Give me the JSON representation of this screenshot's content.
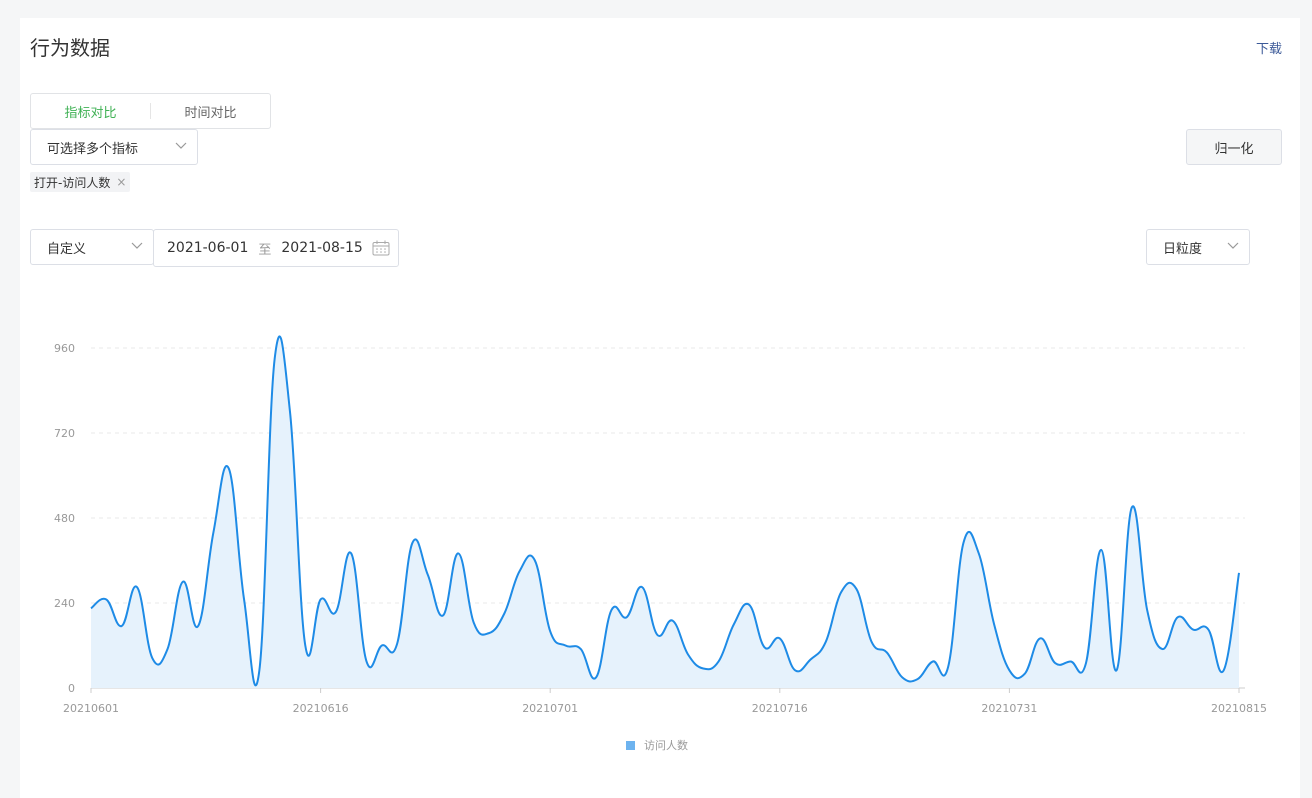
{
  "header": {
    "title": "行为数据",
    "download_label": "下载"
  },
  "compare_tabs": [
    {
      "label": "指标对比",
      "active": true
    },
    {
      "label": "时间对比",
      "active": false
    }
  ],
  "metric_select": {
    "placeholder": "可选择多个指标",
    "icon": "chevron-down-icon"
  },
  "normalize_button": {
    "label": "归一化"
  },
  "selected_tags": [
    {
      "label": "打开-访问人数",
      "icon": "close-icon"
    }
  ],
  "range_select": {
    "value": "自定义",
    "icon": "chevron-down-icon"
  },
  "date_range": {
    "start": "2021-06-01",
    "separator": "至",
    "end": "2021-08-15",
    "icon": "calendar-icon"
  },
  "granularity_select": {
    "value": "日粒度",
    "icon": "chevron-down-icon"
  },
  "colors": {
    "accent": "#3fb154",
    "line": "#1e8be6",
    "area": "#e6f2fc",
    "legend": "#6db3ef"
  },
  "chart_data": {
    "type": "area",
    "title": "",
    "xlabel": "",
    "ylabel": "",
    "ylim": [
      0,
      960
    ],
    "y_ticks": [
      "0",
      "240",
      "480",
      "720",
      "960"
    ],
    "x_ticks": [
      "20210601",
      "20210616",
      "20210701",
      "20210716",
      "20210731",
      "20210815"
    ],
    "grid": true,
    "legend_position": "bottom",
    "x": [
      "20210601",
      "20210602",
      "20210603",
      "20210604",
      "20210605",
      "20210606",
      "20210607",
      "20210608",
      "20210609",
      "20210610",
      "20210611",
      "20210612",
      "20210613",
      "20210614",
      "20210615",
      "20210616",
      "20210617",
      "20210618",
      "20210619",
      "20210620",
      "20210621",
      "20210622",
      "20210623",
      "20210624",
      "20210625",
      "20210626",
      "20210627",
      "20210628",
      "20210629",
      "20210630",
      "20210701",
      "20210702",
      "20210703",
      "20210704",
      "20210705",
      "20210706",
      "20210707",
      "20210708",
      "20210709",
      "20210710",
      "20210711",
      "20210712",
      "20210713",
      "20210714",
      "20210715",
      "20210716",
      "20210717",
      "20210718",
      "20210719",
      "20210720",
      "20210721",
      "20210722",
      "20210723",
      "20210724",
      "20210725",
      "20210726",
      "20210727",
      "20210728",
      "20210729",
      "20210730",
      "20210731",
      "20210801",
      "20210802",
      "20210803",
      "20210804",
      "20210805",
      "20210806",
      "20210807",
      "20210808",
      "20210809",
      "20210810",
      "20210811",
      "20210812",
      "20210813",
      "20210814",
      "20210815"
    ],
    "series": [
      {
        "name": "访问人数",
        "values": [
          225,
          250,
          175,
          285,
          85,
          110,
          300,
          175,
          440,
          620,
          250,
          50,
          930,
          780,
          120,
          250,
          215,
          380,
          75,
          120,
          125,
          410,
          320,
          205,
          380,
          185,
          155,
          210,
          330,
          360,
          160,
          120,
          110,
          30,
          220,
          200,
          285,
          150,
          190,
          95,
          55,
          75,
          180,
          235,
          115,
          140,
          50,
          80,
          130,
          270,
          280,
          130,
          100,
          30,
          25,
          75,
          60,
          410,
          380,
          180,
          50,
          40,
          140,
          70,
          75,
          70,
          390,
          50,
          510,
          220,
          110,
          200,
          165,
          165,
          50,
          325
        ]
      }
    ]
  }
}
